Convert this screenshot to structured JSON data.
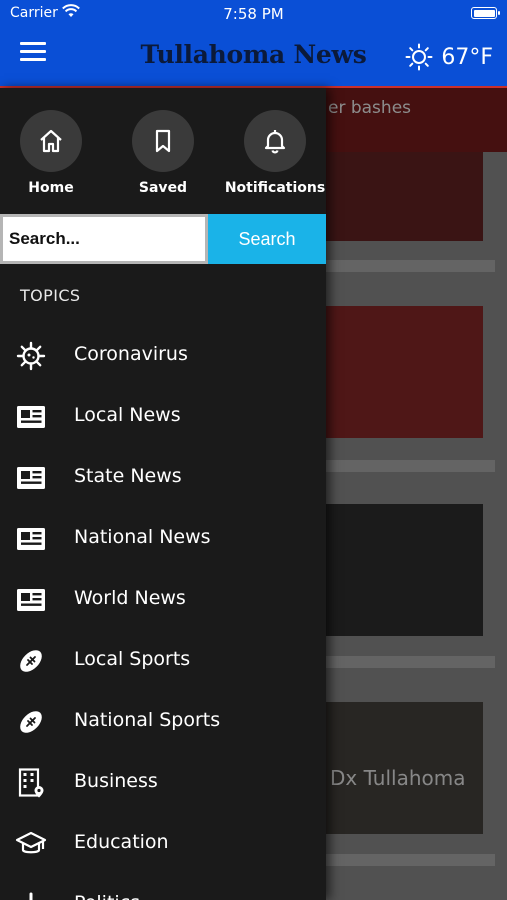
{
  "status_bar": {
    "carrier": "Carrier",
    "time": "7:58 PM"
  },
  "header": {
    "title": "Tullahoma News",
    "temperature": "67°F"
  },
  "background": {
    "banner_text": "er bashes",
    "card_text": "Dx Tullahoma"
  },
  "quick_actions": [
    {
      "label": "Home",
      "icon": "home-icon"
    },
    {
      "label": "Saved",
      "icon": "bookmark-icon"
    },
    {
      "label": "Notifications",
      "icon": "bell-icon"
    }
  ],
  "search": {
    "placeholder": "Search...",
    "button_label": "Search"
  },
  "topics": {
    "heading": "TOPICS",
    "items": [
      {
        "label": "Coronavirus",
        "icon": "virus-icon"
      },
      {
        "label": "Local News",
        "icon": "newspaper-icon"
      },
      {
        "label": "State News",
        "icon": "newspaper-icon"
      },
      {
        "label": "National News",
        "icon": "newspaper-icon"
      },
      {
        "label": "World News",
        "icon": "newspaper-icon"
      },
      {
        "label": "Local Sports",
        "icon": "football-icon"
      },
      {
        "label": "National Sports",
        "icon": "football-icon"
      },
      {
        "label": "Business",
        "icon": "building-icon"
      },
      {
        "label": "Education",
        "icon": "graduation-cap-icon"
      },
      {
        "label": "Politics",
        "icon": "plus-icon"
      }
    ]
  },
  "colors": {
    "header_bg": "#0a4fd6",
    "drawer_bg": "#1a1a1a",
    "search_button": "#1ab3e8",
    "accent_line": "#c9302c"
  }
}
